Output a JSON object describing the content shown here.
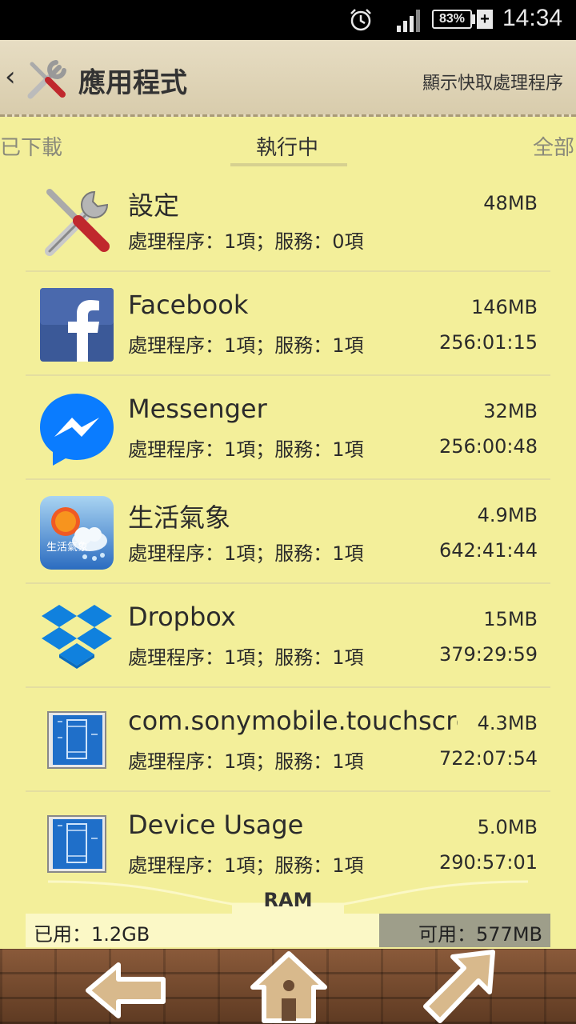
{
  "status_bar": {
    "battery": "83%",
    "charging": "+",
    "time": "14:34"
  },
  "action_bar": {
    "back": "‹",
    "title": "應用程式",
    "action": "顯示快取處理程序"
  },
  "tabs": {
    "left": "已下載",
    "center": "執行中",
    "right": "全部"
  },
  "apps": [
    {
      "name": "設定",
      "size": "48MB",
      "sub": "處理程序：1項；服務：0項",
      "time": "",
      "icon": "settings-icon"
    },
    {
      "name": "Facebook",
      "size": "146MB",
      "sub": "處理程序：1項；服務：1項",
      "time": "256:01:15",
      "icon": "facebook-icon"
    },
    {
      "name": "Messenger",
      "size": "32MB",
      "sub": "處理程序：1項；服務：1項",
      "time": "256:00:48",
      "icon": "messenger-icon"
    },
    {
      "name": "生活氣象",
      "size": "4.9MB",
      "sub": "處理程序：1項；服務：1項",
      "time": "642:41:44",
      "icon": "weather-icon",
      "icon_text": "生活氣象"
    },
    {
      "name": "Dropbox",
      "size": "15MB",
      "sub": "處理程序：1項；服務：1項",
      "time": "379:29:59",
      "icon": "dropbox-icon"
    },
    {
      "name": "com.sonymobile.touchscreen",
      "size": "4.3MB",
      "sub": "處理程序：1項；服務：1項",
      "time": "722:07:54",
      "icon": "blueprint-app-icon"
    },
    {
      "name": "Device Usage",
      "size": "5.0MB",
      "sub": "處理程序：1項；服務：1項",
      "time": "290:57:01",
      "icon": "blueprint-app-icon"
    }
  ],
  "ram": {
    "label": "RAM",
    "used": "已用：1.2GB",
    "free": "可用：577MB"
  },
  "colors": {
    "background": "#f3ef9a",
    "ram_free_bar": "#9e9e8a",
    "facebook": "#3b5998",
    "messenger": "#0a7cff",
    "dropbox": "#1081de"
  }
}
